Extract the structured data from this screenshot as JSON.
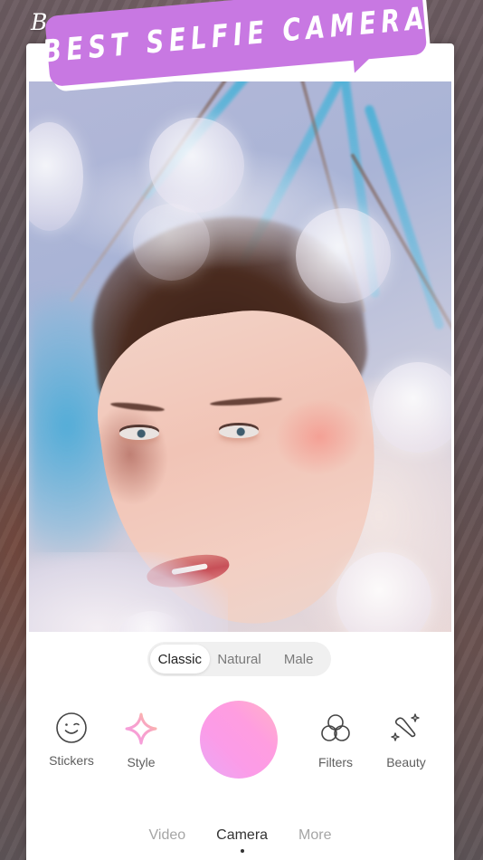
{
  "brand": {
    "name": "BeautyCam",
    "sparkle": "✦"
  },
  "banner": {
    "text": "BEST SELFIE CAMERA",
    "color": "#c878e2"
  },
  "photo": {
    "description": "Selfie preview with bokeh effect"
  },
  "mode_switch": {
    "options": [
      {
        "label": "Classic",
        "active": true
      },
      {
        "label": "Natural",
        "active": false
      },
      {
        "label": "Male",
        "active": false
      }
    ]
  },
  "tools": {
    "stickers": {
      "label": "Stickers",
      "icon": "smiley-icon"
    },
    "style": {
      "label": "Style",
      "icon": "sparkle-icon"
    },
    "filters": {
      "label": "Filters",
      "icon": "three-circles-icon"
    },
    "beauty": {
      "label": "Beauty",
      "icon": "magic-wand-icon"
    }
  },
  "shutter": {
    "label": "Take photo",
    "gradient": [
      "#ffb3c8",
      "#ff9de0",
      "#e9a8f5"
    ]
  },
  "bottom_tabs": [
    {
      "label": "Video",
      "active": false
    },
    {
      "label": "Camera",
      "active": true
    },
    {
      "label": "More",
      "active": false
    }
  ]
}
